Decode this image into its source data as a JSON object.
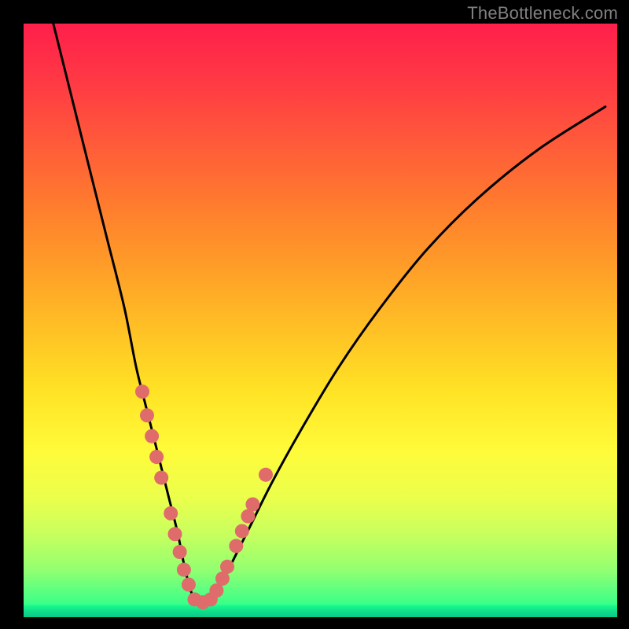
{
  "watermark": "TheBottleneck.com",
  "chart_data": {
    "type": "line",
    "title": "",
    "xlabel": "",
    "ylabel": "",
    "xlim": [
      0,
      100
    ],
    "ylim": [
      0,
      100
    ],
    "series": [
      {
        "name": "bottleneck-curve",
        "x": [
          5,
          8,
          11,
          14,
          17,
          19,
          21,
          23,
          24.5,
          26,
          27,
          28,
          29,
          30,
          31.5,
          33,
          35,
          38,
          42,
          47,
          53,
          60,
          68,
          77,
          87,
          98
        ],
        "y": [
          100,
          88,
          76,
          64,
          52,
          42,
          34,
          26,
          20,
          14,
          9,
          5,
          2.5,
          2.5,
          3,
          5,
          9,
          15,
          23,
          32,
          42,
          52,
          62,
          71,
          79,
          86
        ]
      }
    ],
    "markers": {
      "name": "highlight-dots",
      "color": "#e06b6b",
      "radius_px": 9,
      "points_xy": [
        [
          20.0,
          38.0
        ],
        [
          20.8,
          34.0
        ],
        [
          21.6,
          30.5
        ],
        [
          22.4,
          27.0
        ],
        [
          23.2,
          23.5
        ],
        [
          24.8,
          17.5
        ],
        [
          25.5,
          14.0
        ],
        [
          26.3,
          11.0
        ],
        [
          27.0,
          8.0
        ],
        [
          27.8,
          5.5
        ],
        [
          28.8,
          3.0
        ],
        [
          30.2,
          2.5
        ],
        [
          31.5,
          3.0
        ],
        [
          32.5,
          4.5
        ],
        [
          33.5,
          6.5
        ],
        [
          34.3,
          8.5
        ],
        [
          35.8,
          12.0
        ],
        [
          36.8,
          14.5
        ],
        [
          37.8,
          17.0
        ],
        [
          38.6,
          19.0
        ],
        [
          40.8,
          24.0
        ]
      ]
    }
  }
}
